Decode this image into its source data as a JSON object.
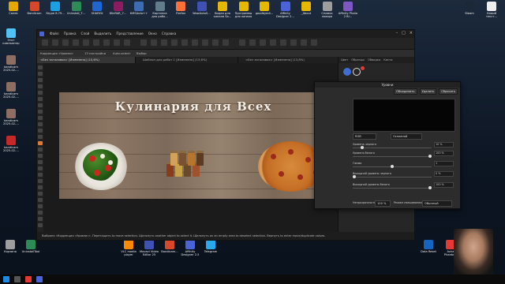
{
  "desktop_icons_top": [
    {
      "label": "Санек",
      "color": "#e6a800"
    },
    {
      "label": "Bandicam",
      "color": "#d9472b"
    },
    {
      "label": "Skype 8.79…",
      "color": "#1ba1e2"
    },
    {
      "label": "Uninstall_T…",
      "color": "#2e8b57"
    },
    {
      "label": "SHAREit",
      "color": "#1f66d1"
    },
    {
      "label": "WinRAR_7…",
      "color": "#8b1c5f"
    },
    {
      "label": "KMSAuto++",
      "color": "#3c6db3"
    },
    {
      "label": "Картинка для рабо…",
      "color": "#607d8b"
    },
    {
      "label": "Firefox",
      "color": "#ff7139"
    },
    {
      "label": "WowAutoS…",
      "color": "#3f51b5"
    },
    {
      "label": "Видео для канала Sa…",
      "color": "#e6b800"
    },
    {
      "label": "Программы для канала",
      "color": "#e6b800"
    },
    {
      "label": "goodbyedl…",
      "color": "#e6b800"
    },
    {
      "label": "Affinity Designer 2…",
      "color": "#4a63d8"
    },
    {
      "label": "_About",
      "color": "#e6b800"
    },
    {
      "label": "Снимок повара",
      "color": "#9e9e9e"
    },
    {
      "label": "Affinity Photo 2 Bl…",
      "color": "#7e57c2"
    }
  ],
  "desktop_icons_left": [
    {
      "label": "Этот компьютер",
      "color": "#4fc3f7"
    },
    {
      "label": "bandicam 2025-02-…",
      "color": "#8d6e63"
    },
    {
      "label": "bandicam 2025-02-…",
      "color": "#8d6e63"
    },
    {
      "label": "bandicam 2025-02-…",
      "color": "#8d6e63"
    },
    {
      "label": "bandicam 2025-02-…",
      "color": "#c62828"
    }
  ],
  "desktop_icons_right": [
    {
      "label": "Steam",
      "color": "#1b2838"
    },
    {
      "label": "Новый текст…",
      "color": "#eeeeee"
    }
  ],
  "desktop_icons_bottom": [
    {
      "label": "Корзина",
      "color": "#9e9e9e"
    },
    {
      "label": "UninstallTool",
      "color": "#2e8b57"
    },
    {
      "label": "VLC media player",
      "color": "#ff8800"
    },
    {
      "label": "Movavi Video Editor 25",
      "color": "#3f51b5"
    },
    {
      "label": "Bandicam…",
      "color": "#d9472b"
    },
    {
      "label": "Affinity Designer 2.5",
      "color": "#4a63d8"
    },
    {
      "label": "Telegram",
      "color": "#29a9eb"
    },
    {
      "label": "Data Reset",
      "color": "#1565c0"
    },
    {
      "label": "Avira Phanto…",
      "color": "#e53935"
    }
  ],
  "app": {
    "menu": [
      "Файл",
      "Правка",
      "Слой",
      "Выделить",
      "Представление",
      "Окно",
      "Справка"
    ],
    "context_label": "Коррекция «Уровни»",
    "context_items": [
      "13 настройки",
      "Auto-select:",
      "Выбор"
    ],
    "tabs": [
      {
        "label": "<Без заголовка> [Изменено] (10,6%)",
        "active": true
      },
      {
        "label": "Шаблон для работ 1 [Изменено] (13,6%)",
        "active": false
      },
      {
        "label": "<Без заголовка> [Изменено] (13,8%)",
        "active": false
      }
    ],
    "right_tabs": [
      "Цвет",
      "Образцы",
      "Обводка",
      "Кисти"
    ],
    "statusbar": "Выбрано «Коррекция «Уровни»». Перетащить to move selection. Щелкнуть another object to select it. Щелкнуть on an empty area to deselect selection. Вернуть to enter move/duplicate values."
  },
  "document": {
    "title": "Кулинария для Всех"
  },
  "levels_dialog": {
    "title": "Уровни",
    "buttons": [
      "Объединить",
      "Удалить",
      "Сбросить"
    ],
    "channel_select": "RGB",
    "mode_select": "Основной",
    "rows": [
      {
        "label": "Уровень черного",
        "value": "10 %",
        "knob": 0.1
      },
      {
        "label": "Уровень белого",
        "value": "100 %",
        "knob": 1.0
      },
      {
        "label": "Гамма",
        "value": "1",
        "knob": 0.5
      },
      {
        "label": "Выходной уровень черного",
        "value": "0 %",
        "knob": 0.0
      },
      {
        "label": "Выходной уровень белого",
        "value": "100 %",
        "knob": 1.0
      }
    ],
    "opacity_label": "Непрозрачность:",
    "opacity_value": "100 %",
    "blend_label": "Режим смешивания:",
    "blend_value": "Обычный"
  }
}
